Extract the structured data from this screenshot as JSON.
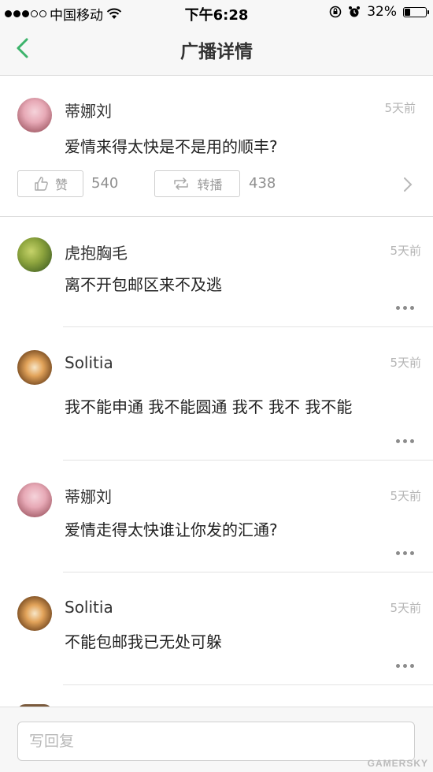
{
  "status_bar": {
    "carrier": "中国移动",
    "time": "下午6:28",
    "battery": "32%",
    "battery_level": 0.32
  },
  "nav": {
    "title": "广播详情"
  },
  "post": {
    "author": "蒂娜刘",
    "time": "5天前",
    "text": "爱情来得太快是不是用的顺丰?",
    "like_label": "赞",
    "like_count": "540",
    "repost_label": "转播",
    "repost_count": "438"
  },
  "comments": [
    {
      "author": "虎抱胸毛",
      "time": "5天前",
      "text": "离不开包邮区来不及逃"
    },
    {
      "author": "Solitia",
      "time": "5天前",
      "text": "我不能申通 我不能圆通 我不 我不 我不能"
    },
    {
      "author": "蒂娜刘",
      "time": "5天前",
      "text": "爱情走得太快谁让你发的汇通?"
    },
    {
      "author": "Solitia",
      "time": "5天前",
      "text": "不能包邮我已无处可躲"
    }
  ],
  "reply": {
    "placeholder": "写回复"
  },
  "watermark": "GAMERSKY",
  "colors": {
    "accent_green": "#3cb36b",
    "bar_bg": "#f7f7f7"
  }
}
